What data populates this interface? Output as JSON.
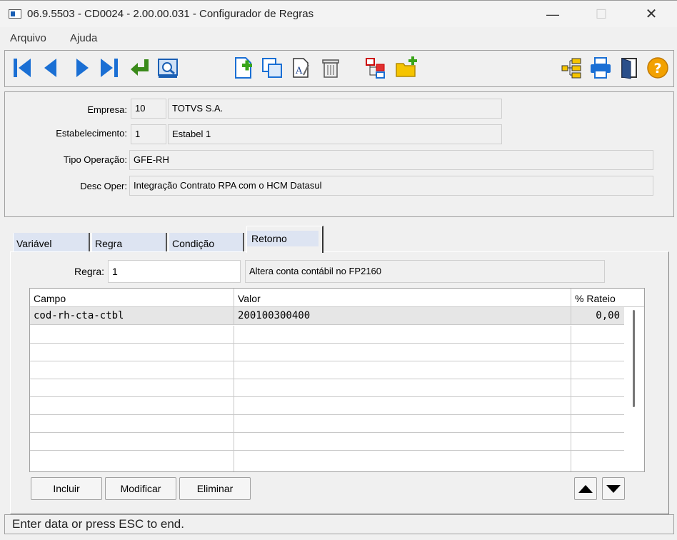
{
  "window": {
    "title": "06.9.5503 - CD0024 - 2.00.00.031 - Configurador de Regras",
    "min_glyph": "—",
    "max_glyph": "☐",
    "close_glyph": "✕"
  },
  "menu": [
    "Arquivo",
    "Ajuda"
  ],
  "toolbar": {
    "icons": [
      "first-icon",
      "prev-icon",
      "next-icon",
      "last-icon",
      "goto-icon",
      "search-icon",
      "new-icon",
      "copy-icon",
      "edit-icon",
      "delete-icon",
      "tree-icon",
      "new-folder-icon",
      "structure-icon",
      "print-icon",
      "exit-icon",
      "help-icon"
    ],
    "help_glyph": "?"
  },
  "header": {
    "empresa": {
      "label": "Empresa:",
      "code": "10",
      "name": "TOTVS S.A."
    },
    "estabelecimento": {
      "label": "Estabelecimento:",
      "code": "1",
      "name": "Estabel 1"
    },
    "tipo_operacao": {
      "label": "Tipo Operação:",
      "value": "GFE-RH"
    },
    "desc_oper": {
      "label": "Desc Oper:",
      "value": "Integração Contrato RPA com o HCM Datasul"
    }
  },
  "tabs": [
    "Variável",
    "Regra",
    "Condição",
    "Retorno"
  ],
  "active_tab": "Retorno",
  "regra": {
    "label": "Regra:",
    "value": "1",
    "desc": "Altera conta contábil no FP2160"
  },
  "grid": {
    "columns": [
      "Campo",
      "Valor",
      "% Rateio"
    ],
    "rows": [
      {
        "campo": "cod-rh-cta-ctbl",
        "valor": "200100300400",
        "rateio": "0,00"
      }
    ]
  },
  "buttons": {
    "incluir": "Incluir",
    "modificar": "Modificar",
    "eliminar": "Eliminar"
  },
  "status": "Enter data or press ESC to end.",
  "colors": {
    "accent_blue": "#1a6fd4",
    "tab_bg": "#dde4f2",
    "help_orange": "#f2a100"
  }
}
